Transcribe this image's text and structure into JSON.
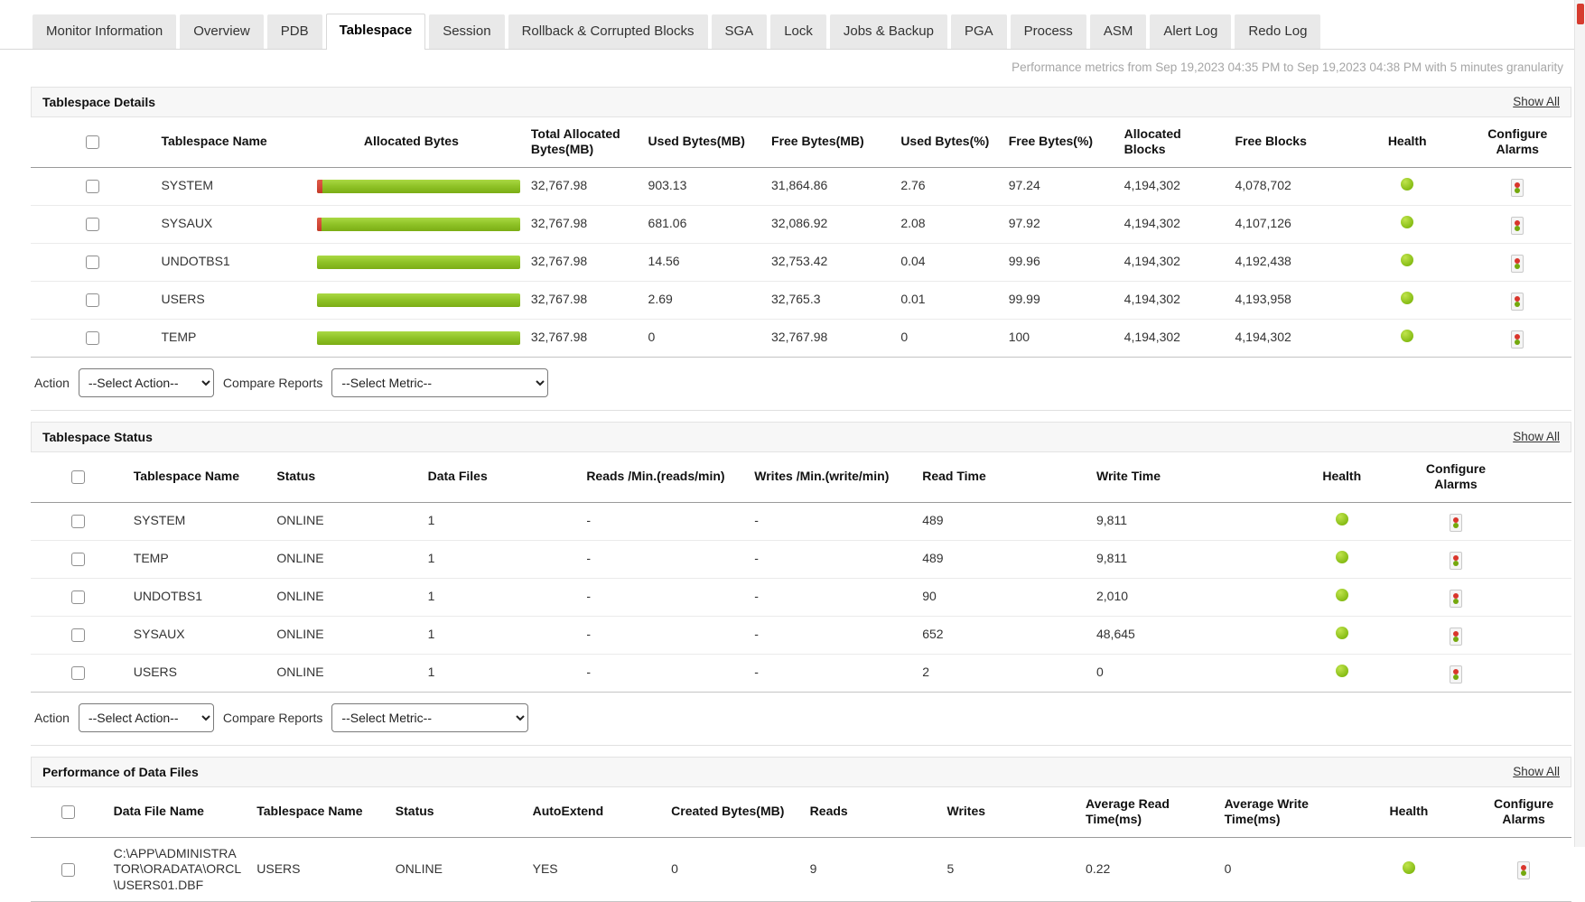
{
  "tabs": {
    "items": [
      {
        "label": "Monitor Information",
        "active": false
      },
      {
        "label": "Overview",
        "active": false
      },
      {
        "label": "PDB",
        "active": false
      },
      {
        "label": "Tablespace",
        "active": true
      },
      {
        "label": "Session",
        "active": false
      },
      {
        "label": "Rollback & Corrupted Blocks",
        "active": false
      },
      {
        "label": "SGA",
        "active": false
      },
      {
        "label": "Lock",
        "active": false
      },
      {
        "label": "Jobs & Backup",
        "active": false
      },
      {
        "label": "PGA",
        "active": false
      },
      {
        "label": "Process",
        "active": false
      },
      {
        "label": "ASM",
        "active": false
      },
      {
        "label": "Alert Log",
        "active": false
      },
      {
        "label": "Redo Log",
        "active": false
      }
    ]
  },
  "meta": {
    "performance_note": "Performance metrics from Sep 19,2023 04:35 PM to Sep 19,2023 04:38 PM with 5 minutes granularity"
  },
  "labels": {
    "action": "Action",
    "select_action": "--Select Action--",
    "compare_reports": "Compare Reports",
    "select_metric": "--Select Metric--",
    "show_all": "Show All"
  },
  "colors": {
    "bar_green": "#8ec226",
    "bar_red": "#c63a2a",
    "health_green": "#83ba12",
    "alarm_red": "#d9352b",
    "alarm_green": "#74a80d"
  },
  "tablespace_details": {
    "title": "Tablespace Details",
    "columns": {
      "name": "Tablespace Name",
      "allocated_bytes": "Allocated Bytes",
      "total_allocated": "Total Allocated Bytes(MB)",
      "used_mb": "Used Bytes(MB)",
      "free_mb": "Free Bytes(MB)",
      "used_pct": "Used Bytes(%)",
      "free_pct": "Free Bytes(%)",
      "alloc_blocks": "Allocated Blocks",
      "free_blocks": "Free Blocks",
      "health": "Health",
      "configure": "Configure Alarms"
    },
    "rows": [
      {
        "name": "SYSTEM",
        "bar_used": 2.76,
        "total": "32,767.98",
        "used": "903.13",
        "free": "31,864.86",
        "used_pct": "2.76",
        "free_pct": "97.24",
        "alloc_blocks": "4,194,302",
        "free_blocks": "4,078,702",
        "health": "green"
      },
      {
        "name": "SYSAUX",
        "bar_used": 2.08,
        "total": "32,767.98",
        "used": "681.06",
        "free": "32,086.92",
        "used_pct": "2.08",
        "free_pct": "97.92",
        "alloc_blocks": "4,194,302",
        "free_blocks": "4,107,126",
        "health": "green"
      },
      {
        "name": "UNDOTBS1",
        "bar_used": 0.04,
        "total": "32,767.98",
        "used": "14.56",
        "free": "32,753.42",
        "used_pct": "0.04",
        "free_pct": "99.96",
        "alloc_blocks": "4,194,302",
        "free_blocks": "4,192,438",
        "health": "green"
      },
      {
        "name": "USERS",
        "bar_used": 0.01,
        "total": "32,767.98",
        "used": "2.69",
        "free": "32,765.3",
        "used_pct": "0.01",
        "free_pct": "99.99",
        "alloc_blocks": "4,194,302",
        "free_blocks": "4,193,958",
        "health": "green"
      },
      {
        "name": "TEMP",
        "bar_used": 0,
        "total": "32,767.98",
        "used": "0",
        "free": "32,767.98",
        "used_pct": "0",
        "free_pct": "100",
        "alloc_blocks": "4,194,302",
        "free_blocks": "4,194,302",
        "health": "green"
      }
    ]
  },
  "tablespace_status": {
    "title": "Tablespace Status",
    "columns": {
      "name": "Tablespace Name",
      "status": "Status",
      "data_files": "Data Files",
      "reads_min": "Reads /Min.(reads/min)",
      "writes_min": "Writes /Min.(write/min)",
      "read_time": "Read Time",
      "write_time": "Write Time",
      "health": "Health",
      "configure": "Configure Alarms"
    },
    "rows": [
      {
        "name": "SYSTEM",
        "status": "ONLINE",
        "data_files": "1",
        "reads_min": "-",
        "writes_min": "-",
        "read_time": "489",
        "write_time": "9,811",
        "health": "green"
      },
      {
        "name": "TEMP",
        "status": "ONLINE",
        "data_files": "1",
        "reads_min": "-",
        "writes_min": "-",
        "read_time": "489",
        "write_time": "9,811",
        "health": "green"
      },
      {
        "name": "UNDOTBS1",
        "status": "ONLINE",
        "data_files": "1",
        "reads_min": "-",
        "writes_min": "-",
        "read_time": "90",
        "write_time": "2,010",
        "health": "green"
      },
      {
        "name": "SYSAUX",
        "status": "ONLINE",
        "data_files": "1",
        "reads_min": "-",
        "writes_min": "-",
        "read_time": "652",
        "write_time": "48,645",
        "health": "green"
      },
      {
        "name": "USERS",
        "status": "ONLINE",
        "data_files": "1",
        "reads_min": "-",
        "writes_min": "-",
        "read_time": "2",
        "write_time": "0",
        "health": "green"
      }
    ]
  },
  "data_files": {
    "title": "Performance of Data Files",
    "columns": {
      "file": "Data File Name",
      "name": "Tablespace Name",
      "status": "Status",
      "autoextend": "AutoExtend",
      "created_mb": "Created Bytes(MB)",
      "reads": "Reads",
      "writes": "Writes",
      "avg_read": "Average Read Time(ms)",
      "avg_write": "Average Write Time(ms)",
      "health": "Health",
      "configure": "Configure Alarms"
    },
    "rows": [
      {
        "file": "C:\\APP\\ADMINISTRATOR\\ORADATA\\ORCL\\USERS01.DBF",
        "name": "USERS",
        "status": "ONLINE",
        "autoextend": "YES",
        "created_mb": "0",
        "reads": "9",
        "writes": "5",
        "avg_read": "0.22",
        "avg_write": "0",
        "health": "green"
      }
    ]
  }
}
